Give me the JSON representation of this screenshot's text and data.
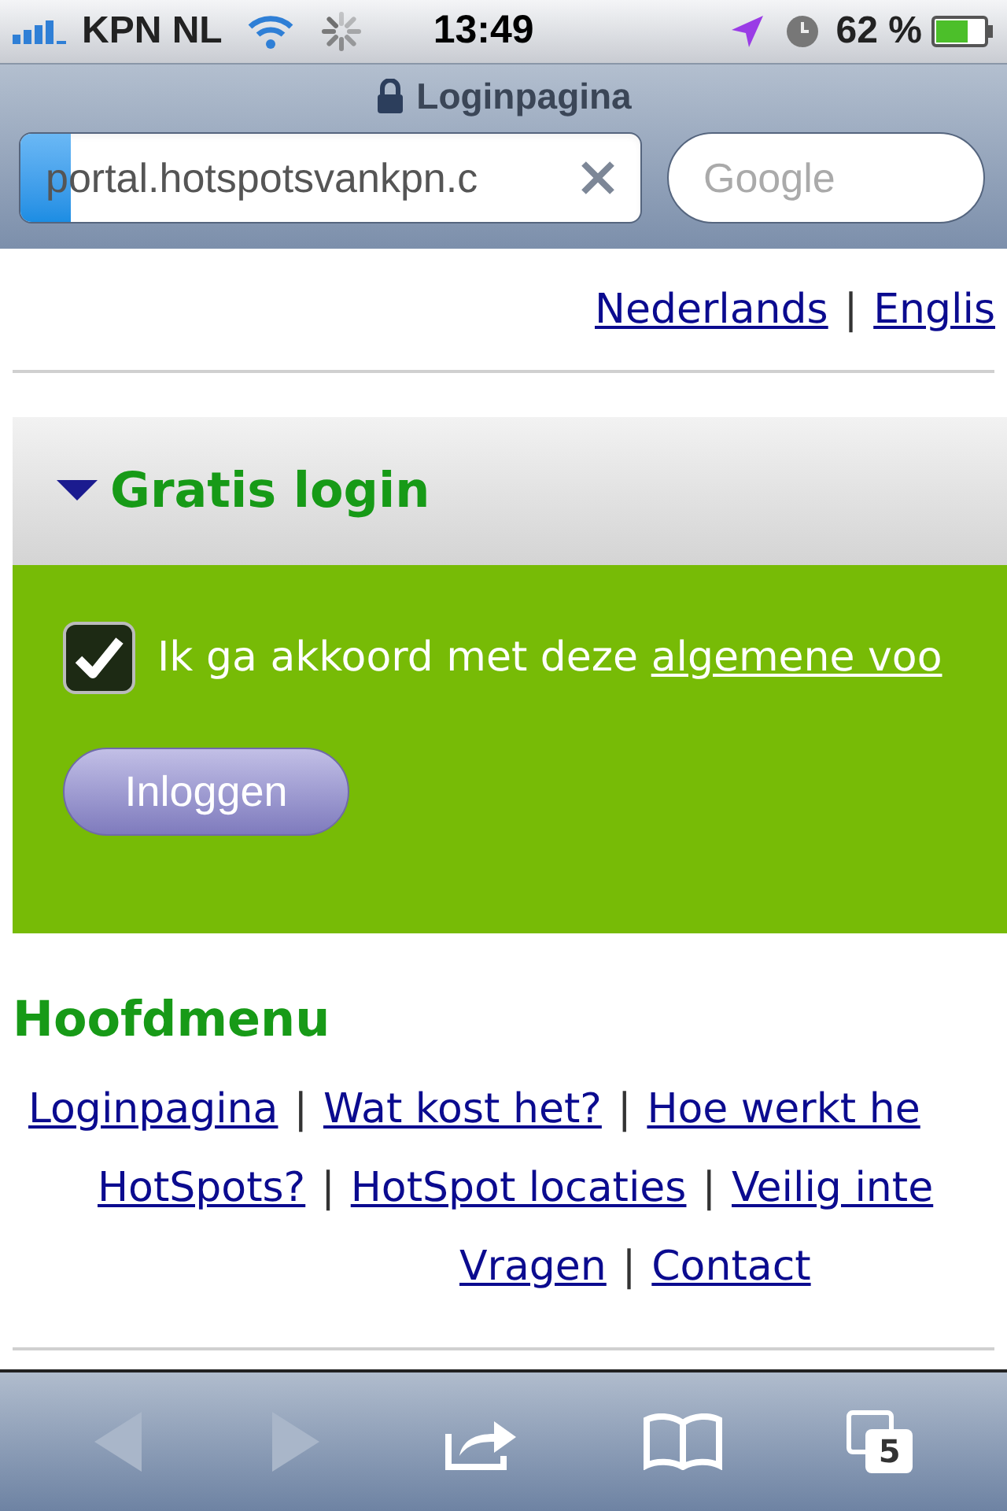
{
  "status_bar": {
    "carrier": "KPN NL",
    "time": "13:49",
    "battery": "62 %"
  },
  "browser": {
    "title": "Loginpagina",
    "url": {
      "value": "portal.hotspotsvankpn.c",
      "level": 0.08
    },
    "search": {
      "placeholder": "Google"
    }
  },
  "languages": [
    {
      "kind": "link",
      "text": "Nederlands"
    },
    {
      "kind": "separator",
      "text": "|"
    },
    {
      "kind": "link",
      "text": "Englis"
    }
  ],
  "login_panel": {
    "title": "Gratis login",
    "expanded": true,
    "agree": {
      "checked": true,
      "text": "Ik ga akkoord met deze ",
      "link": "algemene voo"
    },
    "button": "Inloggen"
  },
  "main_menu": {
    "title": "Hoofdmenu",
    "rows": [
      {
        "items": [
          {
            "kind": "link",
            "text": "Loginpagina"
          },
          {
            "kind": "separator",
            "text": "|"
          },
          {
            "kind": "link",
            "text": "Wat kost het?"
          },
          {
            "kind": "separator",
            "text": "|"
          },
          {
            "kind": "link",
            "text": "Hoe werkt he"
          }
        ]
      },
      {
        "items": [
          {
            "kind": "link",
            "text": "HotSpots?"
          },
          {
            "kind": "separator",
            "text": "|"
          },
          {
            "kind": "link",
            "text": "HotSpot locaties"
          },
          {
            "kind": "separator",
            "text": "|"
          },
          {
            "kind": "link",
            "text": "Veilig inte"
          }
        ]
      },
      {
        "items": [
          {
            "kind": "link",
            "text": "Vragen"
          },
          {
            "kind": "separator",
            "text": "|"
          },
          {
            "kind": "link",
            "text": "Contact"
          }
        ]
      }
    ]
  },
  "toolbar": {
    "back": {
      "disabled": true
    },
    "forward": {
      "disabled": true
    },
    "tabs_count": "5"
  }
}
